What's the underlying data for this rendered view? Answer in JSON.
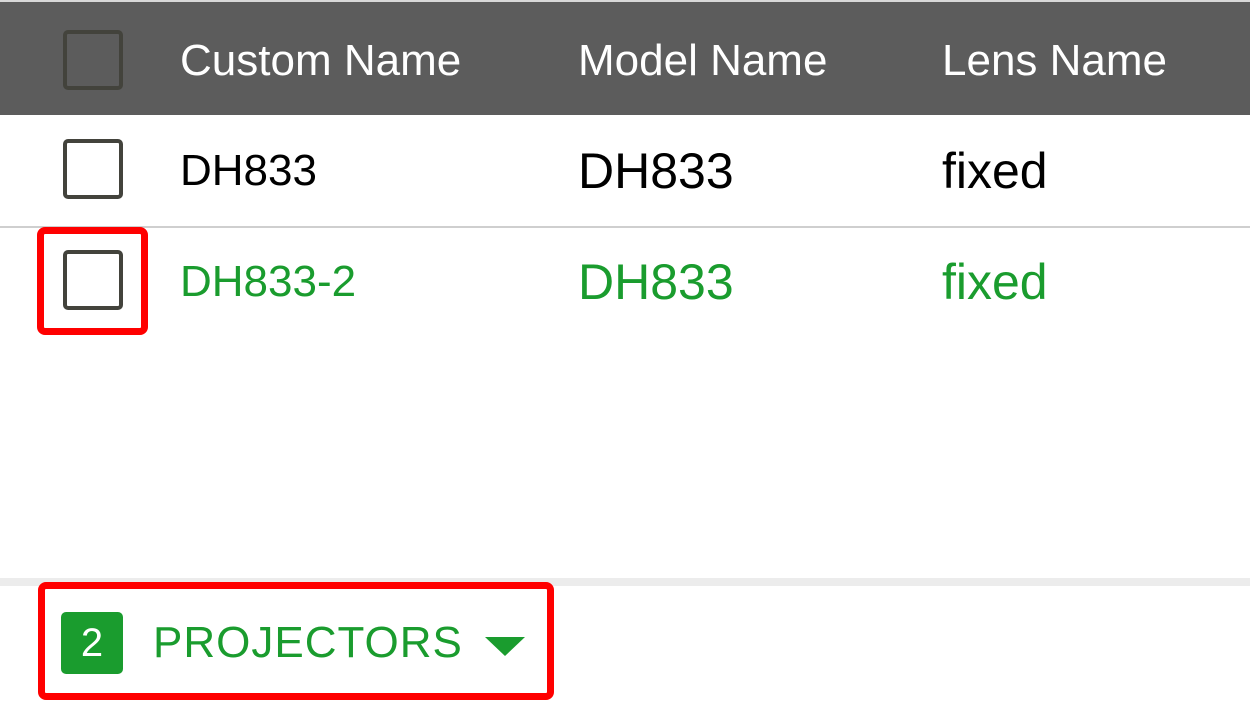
{
  "table": {
    "columns": [
      "Custom Name",
      "Model Name",
      "Lens Name"
    ],
    "rows": [
      {
        "custom_name": "DH833",
        "model_name": "DH833",
        "lens_name": "fixed",
        "checked": false
      },
      {
        "custom_name": "DH833-2",
        "model_name": "DH833",
        "lens_name": "fixed",
        "checked": false
      }
    ]
  },
  "footer": {
    "count": "2",
    "label": "PROJECTORS",
    "dropdown_icon": "caret-down-icon"
  },
  "colors": {
    "header_bg": "#5c5c5c",
    "accent_green": "#1a9c2e",
    "highlight_red": "#ff0000"
  }
}
